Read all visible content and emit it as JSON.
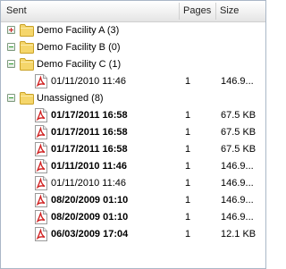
{
  "header": {
    "sent": "Sent",
    "pages": "Pages",
    "size": "Size"
  },
  "folders": [
    {
      "label": "Demo Facility A (3)",
      "toggle": "plus-icon",
      "toggle_color": "#cc2222",
      "expanded": false
    },
    {
      "label": "Demo Facility B (0)",
      "toggle": "minus-icon",
      "toggle_color": "#2a9a2a",
      "expanded": true
    },
    {
      "label": "Demo Facility C (1)",
      "toggle": "minus-icon",
      "toggle_color": "#2a9a2a",
      "expanded": true,
      "files": [
        {
          "date": "01/11/2010 11:46",
          "pages": "1",
          "size": "146.9...",
          "bold": false
        }
      ]
    },
    {
      "label": "Unassigned (8)",
      "toggle": "minus-icon",
      "toggle_color": "#2a9a2a",
      "expanded": true,
      "files": [
        {
          "date": "01/17/2011 16:58",
          "pages": "1",
          "size": "67.5 KB",
          "bold": true
        },
        {
          "date": "01/17/2011 16:58",
          "pages": "1",
          "size": "67.5 KB",
          "bold": true
        },
        {
          "date": "01/17/2011 16:58",
          "pages": "1",
          "size": "67.5 KB",
          "bold": true
        },
        {
          "date": "01/11/2010 11:46",
          "pages": "1",
          "size": "146.9...",
          "bold": true
        },
        {
          "date": "01/11/2010 11:46",
          "pages": "1",
          "size": "146.9...",
          "bold": false
        },
        {
          "date": "08/20/2009 01:10",
          "pages": "1",
          "size": "146.9...",
          "bold": true
        },
        {
          "date": "08/20/2009 01:10",
          "pages": "1",
          "size": "146.9...",
          "bold": true
        },
        {
          "date": "06/03/2009 17:04",
          "pages": "1",
          "size": "12.1 KB",
          "bold": true
        }
      ]
    }
  ],
  "colors": {
    "folder_body": "#f5d66b",
    "folder_border": "#c9a227",
    "pdf_red": "#d02020",
    "header_border": "#cfcfcf"
  },
  "icons": {
    "folder": "folder-icon",
    "file": "pdf-document-icon"
  }
}
